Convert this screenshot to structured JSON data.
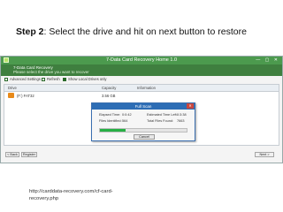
{
  "slide": {
    "step_label": "Step 2",
    "step_text": ": Select the drive and hit on next button to restore",
    "url_line1": "http://carddata-recovery.com/cf-card-",
    "url_line2": "recovery.php"
  },
  "app": {
    "title": "7-Data Card Recovery Home 1.0",
    "header_line1": "7-Data Card Recovery",
    "header_line2": "Please select the drive you want to recover",
    "toolbar": {
      "advanced": "Advanced Settings",
      "refresh": "Refresh",
      "local_only": "Show Local Drives only"
    },
    "columns": {
      "drive": "Drive",
      "capacity": "Capacity",
      "information": "Information"
    },
    "rows": [
      {
        "drive": "(F:) FAT32",
        "capacity": "3.56 GB",
        "information": ""
      }
    ],
    "dialog": {
      "title": "Full Scan",
      "elapsed_label": "Elapsed Time:",
      "elapsed_value": "0:0:42",
      "est_label": "Estimated Time Left:",
      "est_value": "0:3:38",
      "files_label": "Files Identified:",
      "files_value": "564",
      "total_label": "Total Files Found:",
      "total_value": "7663",
      "progress": 0.3,
      "cancel": "Cancel"
    },
    "footer": {
      "back": "< Back",
      "register": "Register",
      "next": "Next >"
    }
  },
  "colors": {
    "titlebar": "#4c9a4e",
    "header": "#3f7f3f",
    "dialog_title": "#2d6db5",
    "progress": "#27b045"
  }
}
